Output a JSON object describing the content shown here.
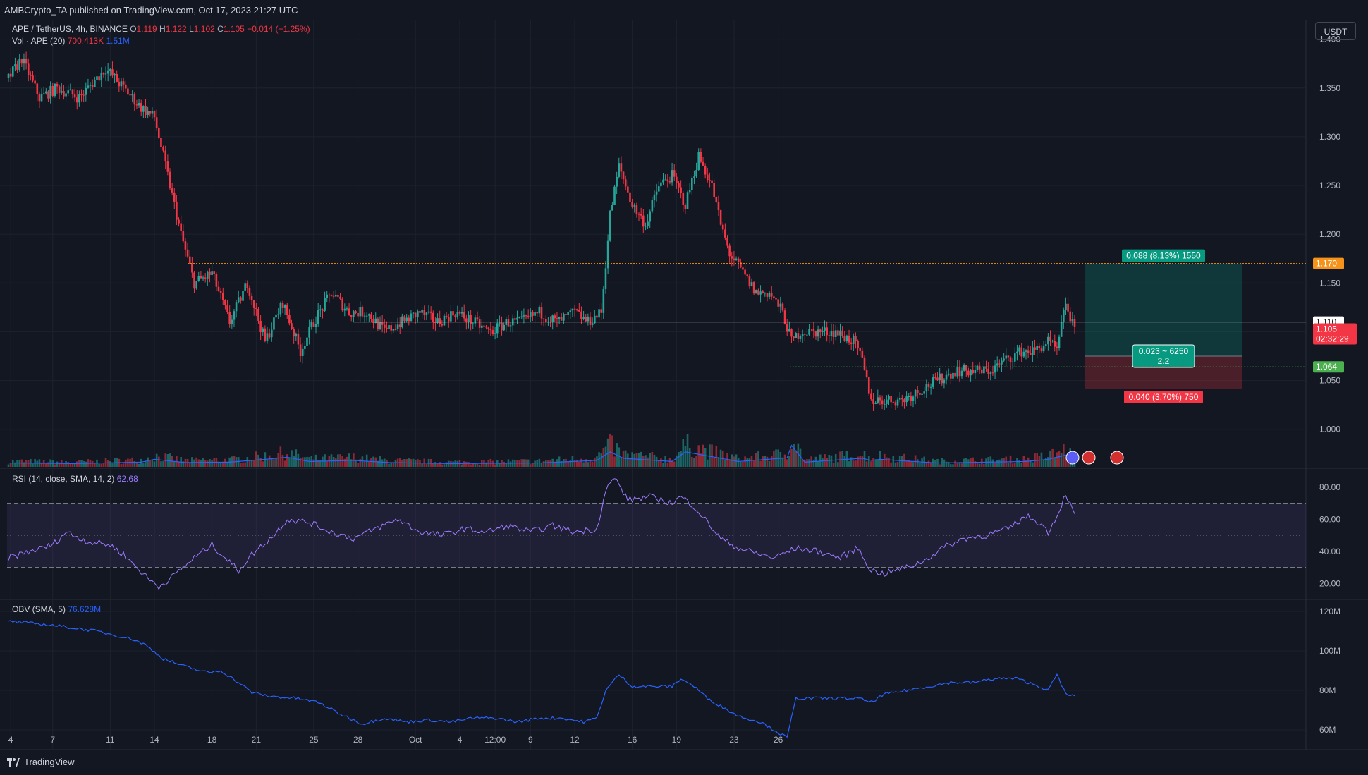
{
  "header": {
    "published": "AMBCrypto_TA published on TradingView.com, Oct 17, 2023 21:27 UTC"
  },
  "legend": {
    "symbol": "APE / TetherUS, 4h, BINANCE",
    "o_label": "O",
    "o": "1.119",
    "h_label": "H",
    "h": "1.122",
    "l_label": "L",
    "l": "1.102",
    "c_label": "C",
    "c": "1.105",
    "change": "−0.014 (−1.25%)",
    "vol_label": "Vol · APE (20)",
    "vol_value": "700.413K",
    "vol_ma": "1.51M"
  },
  "currency_button": "USDT",
  "footer": {
    "brand": "TradingView"
  },
  "chart_data": [
    {
      "type": "candlestick",
      "pane": "price",
      "ylim": [
        0.96,
        1.42
      ],
      "y_ticks": [
        "1.400",
        "1.350",
        "1.300",
        "1.250",
        "1.200",
        "1.150",
        "1.100",
        "1.050",
        "1.000"
      ],
      "x_tick_labels": [
        "4",
        "7",
        "11",
        "14",
        "18",
        "21",
        "25",
        "28",
        "Oct",
        "4",
        "12:00",
        "9",
        "12",
        "16",
        "19",
        "23",
        "26"
      ],
      "price_path": [
        [
          0,
          1.36
        ],
        [
          6,
          1.38
        ],
        [
          14,
          1.34
        ],
        [
          22,
          1.35
        ],
        [
          32,
          1.34
        ],
        [
          44,
          1.37
        ],
        [
          52,
          1.35
        ],
        [
          60,
          1.33
        ],
        [
          66,
          1.32
        ],
        [
          72,
          1.26
        ],
        [
          78,
          1.2
        ],
        [
          84,
          1.15
        ],
        [
          92,
          1.16
        ],
        [
          100,
          1.11
        ],
        [
          108,
          1.15
        ],
        [
          116,
          1.09
        ],
        [
          124,
          1.13
        ],
        [
          132,
          1.08
        ],
        [
          138,
          1.11
        ],
        [
          146,
          1.14
        ],
        [
          154,
          1.12
        ],
        [
          162,
          1.12
        ],
        [
          170,
          1.1
        ],
        [
          178,
          1.11
        ],
        [
          186,
          1.12
        ],
        [
          194,
          1.11
        ],
        [
          202,
          1.12
        ],
        [
          210,
          1.11
        ],
        [
          218,
          1.1
        ],
        [
          226,
          1.11
        ],
        [
          232,
          1.11
        ],
        [
          240,
          1.12
        ],
        [
          248,
          1.11
        ],
        [
          256,
          1.12
        ],
        [
          262,
          1.11
        ],
        [
          268,
          1.12
        ],
        [
          272,
          1.22
        ],
        [
          276,
          1.27
        ],
        [
          282,
          1.23
        ],
        [
          288,
          1.21
        ],
        [
          294,
          1.25
        ],
        [
          300,
          1.26
        ],
        [
          306,
          1.23
        ],
        [
          312,
          1.28
        ],
        [
          318,
          1.25
        ],
        [
          322,
          1.21
        ],
        [
          326,
          1.18
        ],
        [
          332,
          1.16
        ],
        [
          338,
          1.14
        ],
        [
          344,
          1.14
        ],
        [
          350,
          1.12
        ],
        [
          354,
          1.09
        ],
        [
          358,
          1.1
        ],
        [
          366,
          1.1
        ],
        [
          374,
          1.1
        ],
        [
          382,
          1.09
        ],
        [
          386,
          1.07
        ],
        [
          390,
          1.03
        ],
        [
          396,
          1.03
        ],
        [
          404,
          1.03
        ],
        [
          412,
          1.04
        ],
        [
          420,
          1.05
        ],
        [
          428,
          1.06
        ],
        [
          436,
          1.06
        ],
        [
          444,
          1.06
        ],
        [
          450,
          1.07
        ],
        [
          458,
          1.08
        ],
        [
          464,
          1.08
        ],
        [
          470,
          1.09
        ],
        [
          474,
          1.08
        ],
        [
          478,
          1.13
        ],
        [
          482,
          1.1
        ]
      ],
      "volume_path": [
        [
          0,
          0.18
        ],
        [
          30,
          0.15
        ],
        [
          60,
          0.22
        ],
        [
          66,
          0.35
        ],
        [
          80,
          0.2
        ],
        [
          100,
          0.22
        ],
        [
          116,
          0.35
        ],
        [
          126,
          0.45
        ],
        [
          136,
          0.25
        ],
        [
          156,
          0.3
        ],
        [
          172,
          0.2
        ],
        [
          200,
          0.15
        ],
        [
          240,
          0.18
        ],
        [
          266,
          0.3
        ],
        [
          272,
          0.7
        ],
        [
          278,
          0.4
        ],
        [
          300,
          0.25
        ],
        [
          306,
          0.7
        ],
        [
          330,
          0.25
        ],
        [
          352,
          0.42
        ],
        [
          354,
          1.0
        ],
        [
          360,
          0.22
        ],
        [
          386,
          0.4
        ],
        [
          390,
          0.3
        ],
        [
          394,
          0.35
        ],
        [
          420,
          0.18
        ],
        [
          460,
          0.25
        ],
        [
          470,
          0.35
        ],
        [
          476,
          0.5
        ],
        [
          478,
          0.55
        ],
        [
          482,
          0.25
        ]
      ],
      "horizontal_levels": [
        {
          "price": 1.17,
          "label": "1.170",
          "color": "#f7931a",
          "style": "dotted"
        },
        {
          "price": 1.11,
          "label": "1.110",
          "color": "#ffffff",
          "style": "solid"
        },
        {
          "price": 1.064,
          "label": "1.064",
          "color": "#4caf50",
          "style": "dotted"
        }
      ],
      "last_price": {
        "value": "1.105",
        "countdown": "02:32:29",
        "color": "#f23645"
      },
      "position_tool": {
        "entry": 1.075,
        "target": 1.17,
        "stop": 1.041,
        "target_label": "0.088 (8.13%) 1550",
        "stop_label": "0.040 (3.70%) 750",
        "center_label": "0.023 ~ 6250",
        "ratio_label": "2.2"
      },
      "colors": {
        "up": "#26a69a",
        "down": "#f23645",
        "vol_ma": "#2962ff"
      }
    },
    {
      "type": "line",
      "pane": "rsi",
      "title": "RSI (14, close, SMA, 14, 2)",
      "last_value": "62.68",
      "ylim": [
        10,
        90
      ],
      "y_ticks": [
        "80.00",
        "60.00",
        "40.00",
        "20.00"
      ],
      "bands": [
        70,
        50,
        30
      ],
      "path": [
        [
          0,
          36
        ],
        [
          10,
          40
        ],
        [
          20,
          44
        ],
        [
          26,
          52
        ],
        [
          36,
          46
        ],
        [
          46,
          44
        ],
        [
          52,
          38
        ],
        [
          58,
          30
        ],
        [
          64,
          22
        ],
        [
          68,
          18
        ],
        [
          74,
          24
        ],
        [
          84,
          36
        ],
        [
          92,
          44
        ],
        [
          98,
          36
        ],
        [
          104,
          28
        ],
        [
          110,
          38
        ],
        [
          120,
          50
        ],
        [
          126,
          60
        ],
        [
          136,
          58
        ],
        [
          146,
          52
        ],
        [
          156,
          48
        ],
        [
          166,
          54
        ],
        [
          176,
          60
        ],
        [
          186,
          52
        ],
        [
          196,
          50
        ],
        [
          206,
          54
        ],
        [
          216,
          52
        ],
        [
          226,
          56
        ],
        [
          236,
          52
        ],
        [
          246,
          56
        ],
        [
          256,
          52
        ],
        [
          266,
          54
        ],
        [
          270,
          78
        ],
        [
          274,
          86
        ],
        [
          280,
          72
        ],
        [
          290,
          74
        ],
        [
          300,
          70
        ],
        [
          304,
          74
        ],
        [
          310,
          68
        ],
        [
          316,
          58
        ],
        [
          322,
          48
        ],
        [
          330,
          42
        ],
        [
          340,
          38
        ],
        [
          346,
          36
        ],
        [
          356,
          42
        ],
        [
          366,
          40
        ],
        [
          376,
          36
        ],
        [
          384,
          42
        ],
        [
          390,
          28
        ],
        [
          396,
          26
        ],
        [
          406,
          30
        ],
        [
          414,
          34
        ],
        [
          422,
          42
        ],
        [
          432,
          48
        ],
        [
          442,
          50
        ],
        [
          452,
          54
        ],
        [
          460,
          62
        ],
        [
          466,
          58
        ],
        [
          470,
          52
        ],
        [
          474,
          62
        ],
        [
          478,
          76
        ],
        [
          482,
          62
        ]
      ],
      "color": "#9c7cff"
    },
    {
      "type": "line",
      "pane": "obv",
      "title": "OBV (SMA, 5)",
      "last_value": "76.628M",
      "ylim": [
        50,
        125
      ],
      "y_ticks": [
        "120M",
        "100M",
        "80M",
        "60M"
      ],
      "path": [
        [
          0,
          115
        ],
        [
          20,
          113
        ],
        [
          40,
          110
        ],
        [
          56,
          106
        ],
        [
          62,
          103
        ],
        [
          70,
          96
        ],
        [
          80,
          92
        ],
        [
          90,
          89
        ],
        [
          96,
          90
        ],
        [
          104,
          84
        ],
        [
          110,
          79
        ],
        [
          118,
          77
        ],
        [
          130,
          76
        ],
        [
          140,
          74
        ],
        [
          150,
          68
        ],
        [
          160,
          63
        ],
        [
          170,
          66
        ],
        [
          180,
          64
        ],
        [
          190,
          65
        ],
        [
          200,
          64
        ],
        [
          210,
          66
        ],
        [
          220,
          66
        ],
        [
          230,
          64
        ],
        [
          240,
          66
        ],
        [
          250,
          66
        ],
        [
          260,
          64
        ],
        [
          266,
          66
        ],
        [
          270,
          80
        ],
        [
          276,
          88
        ],
        [
          282,
          82
        ],
        [
          290,
          82
        ],
        [
          300,
          82
        ],
        [
          304,
          86
        ],
        [
          310,
          82
        ],
        [
          316,
          76
        ],
        [
          322,
          72
        ],
        [
          330,
          67
        ],
        [
          340,
          64
        ],
        [
          346,
          60
        ],
        [
          352,
          56
        ],
        [
          356,
          76
        ],
        [
          364,
          76
        ],
        [
          374,
          76
        ],
        [
          384,
          76
        ],
        [
          390,
          74
        ],
        [
          396,
          78
        ],
        [
          406,
          80
        ],
        [
          416,
          82
        ],
        [
          426,
          84
        ],
        [
          436,
          84
        ],
        [
          446,
          86
        ],
        [
          456,
          86
        ],
        [
          466,
          82
        ],
        [
          470,
          80
        ],
        [
          474,
          88
        ],
        [
          478,
          78
        ],
        [
          482,
          77
        ]
      ],
      "color": "#2962ff"
    }
  ]
}
